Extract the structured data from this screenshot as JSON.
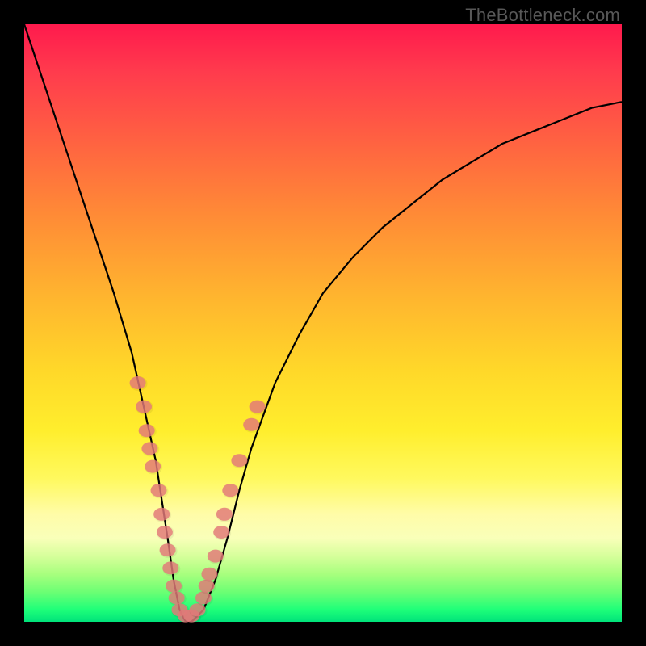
{
  "watermark_text": "TheBottleneck.com",
  "colors": {
    "frame": "#000000",
    "curve": "#000000",
    "dot_fill": "#e47a7a"
  },
  "chart_data": {
    "type": "line",
    "title": "",
    "xlabel": "",
    "ylabel": "",
    "xlim": [
      0,
      100
    ],
    "ylim": [
      0,
      100
    ],
    "grid": false,
    "legend": false,
    "annotations": [],
    "series": [
      {
        "name": "bottleneck-curve",
        "x": [
          0,
          3,
          6,
          9,
          12,
          15,
          18,
          20,
          22,
          24,
          25,
          26,
          27,
          28,
          30,
          32,
          34,
          36,
          38,
          42,
          46,
          50,
          55,
          60,
          65,
          70,
          75,
          80,
          85,
          90,
          95,
          100
        ],
        "y": [
          100,
          91,
          82,
          73,
          64,
          55,
          45,
          36,
          27,
          14,
          7,
          2,
          0,
          0,
          2,
          7,
          14,
          22,
          29,
          40,
          48,
          55,
          61,
          66,
          70,
          74,
          77,
          80,
          82,
          84,
          86,
          87
        ]
      }
    ],
    "data_points": [
      {
        "x": 19,
        "y": 40
      },
      {
        "x": 20,
        "y": 36
      },
      {
        "x": 20.5,
        "y": 32
      },
      {
        "x": 21,
        "y": 29
      },
      {
        "x": 21.5,
        "y": 26
      },
      {
        "x": 22.5,
        "y": 22
      },
      {
        "x": 23,
        "y": 18
      },
      {
        "x": 23.5,
        "y": 15
      },
      {
        "x": 24,
        "y": 12
      },
      {
        "x": 24.5,
        "y": 9
      },
      {
        "x": 25,
        "y": 6
      },
      {
        "x": 25.5,
        "y": 4
      },
      {
        "x": 26,
        "y": 2
      },
      {
        "x": 27,
        "y": 1
      },
      {
        "x": 28,
        "y": 1
      },
      {
        "x": 29,
        "y": 2
      },
      {
        "x": 30,
        "y": 4
      },
      {
        "x": 30.5,
        "y": 6
      },
      {
        "x": 31,
        "y": 8
      },
      {
        "x": 32,
        "y": 11
      },
      {
        "x": 33,
        "y": 15
      },
      {
        "x": 33.5,
        "y": 18
      },
      {
        "x": 34.5,
        "y": 22
      },
      {
        "x": 36,
        "y": 27
      },
      {
        "x": 38,
        "y": 33
      },
      {
        "x": 39,
        "y": 36
      }
    ]
  }
}
